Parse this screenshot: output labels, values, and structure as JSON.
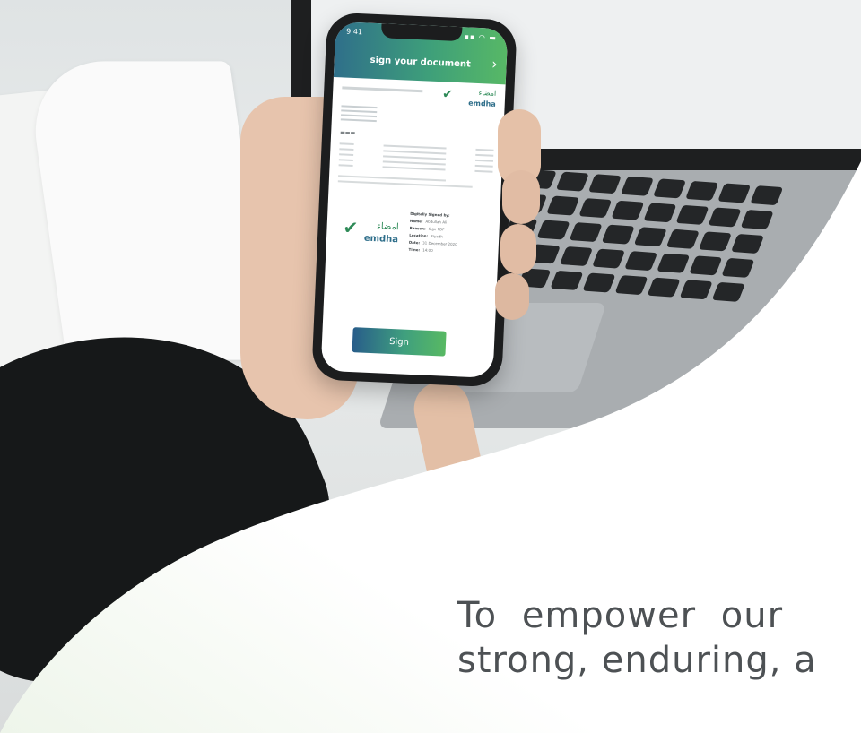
{
  "phone": {
    "status_time": "9:41",
    "status_icons": "▪▪ ◠ ▬",
    "header_title": "sign your document",
    "logo": {
      "arabic": "امضاء",
      "latin": "emdha"
    }
  },
  "signature": {
    "title": "Digitally Signed by:",
    "name_label": "Name:",
    "name_value": "Abdullah Ali",
    "reason_label": "Reason:",
    "reason_value": "Sign PDF",
    "location_label": "Location:",
    "location_value": "Riyadh",
    "date_label": "Date:",
    "date_value": "31 December 2020",
    "time_label": "Time:",
    "time_value": "14:00"
  },
  "sign_button_label": "Sign",
  "tagline": {
    "line1": "To empower our",
    "line2": "strong, enduring, a"
  },
  "colors": {
    "brand_blue": "#285d8a",
    "brand_green": "#58b963",
    "tagline": "#4d5154"
  }
}
